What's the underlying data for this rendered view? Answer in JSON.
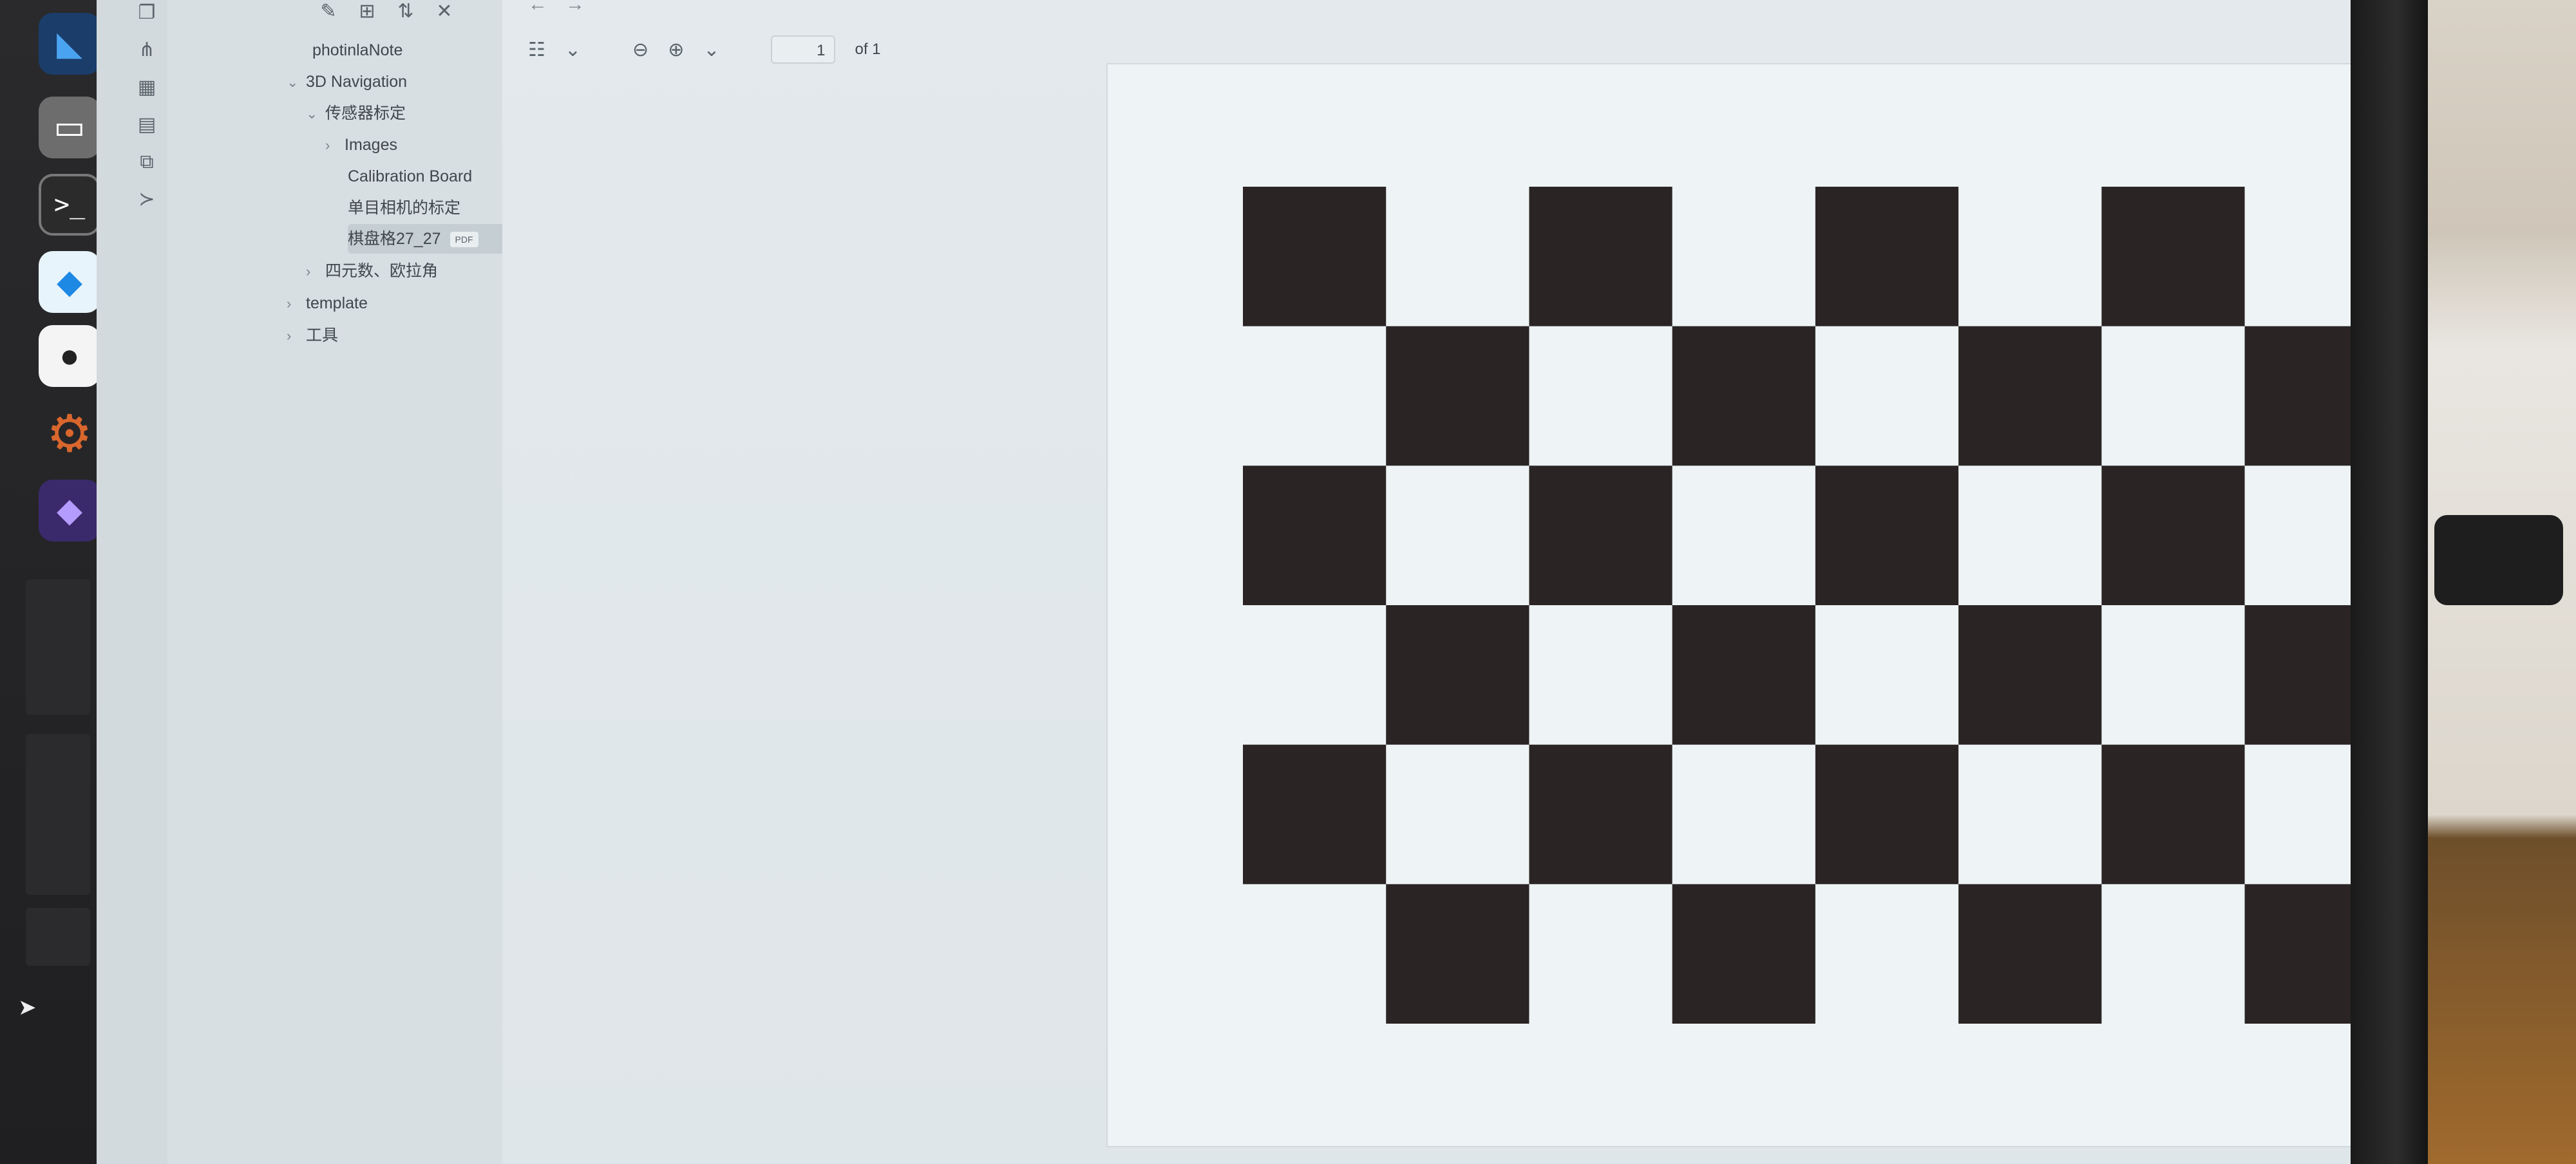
{
  "dock": {
    "icons": [
      "vscode-icon",
      "files-icon",
      "terminal-icon",
      "azure-icon",
      "clash-icon",
      "settings-icon",
      "obsidian-icon"
    ],
    "terminal_glyph": ">_"
  },
  "ribbon": {
    "icons": [
      "files-icon",
      "graph-icon",
      "grid-icon",
      "calendar-icon",
      "copy-icon",
      "terminal-icon"
    ]
  },
  "sidebar": {
    "tools": [
      "new-note-icon",
      "new-folder-icon",
      "sort-icon",
      "collapse-icon"
    ],
    "vault_name": "photinlaNote",
    "tree": [
      {
        "label": "3D Navigation",
        "chev": "⌄"
      },
      {
        "label": "传感器标定",
        "chev": "⌄"
      },
      {
        "label": "Images",
        "chev": "›"
      },
      {
        "label": "Calibration Board",
        "chev": ""
      },
      {
        "label": "单目相机的标定",
        "chev": ""
      },
      {
        "label": "棋盘格27_27",
        "chev": "",
        "badge": "PDF"
      },
      {
        "label": "四元数、欧拉角",
        "chev": "›"
      },
      {
        "label": "template",
        "chev": "›"
      },
      {
        "label": "工具",
        "chev": "›"
      }
    ]
  },
  "viewer": {
    "nav_back": "←",
    "nav_forward": "→",
    "page_current": "1",
    "page_of": "of 1"
  },
  "checkerboard": {
    "rows": 6,
    "cols": 9,
    "dark_color": "#2a2424",
    "light_color": "#eef3f5",
    "first_cell_dark": true
  }
}
